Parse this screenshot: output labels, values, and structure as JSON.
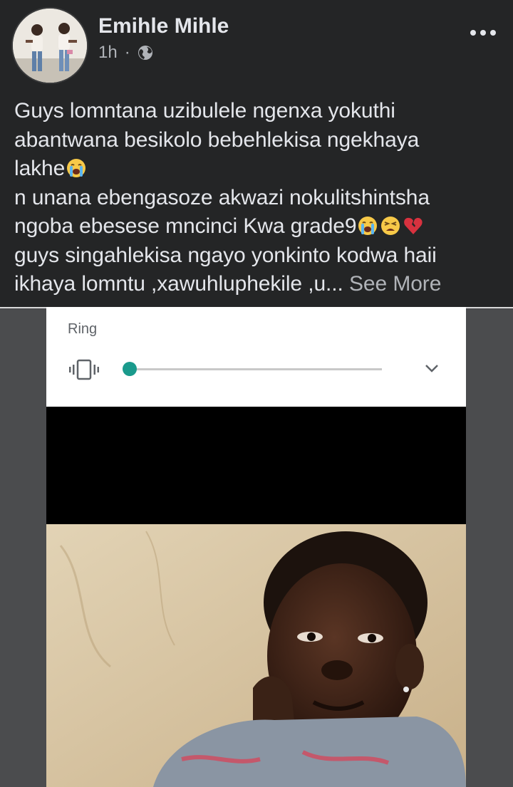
{
  "post": {
    "author": "Emihle Mihle",
    "time": "1h",
    "separator": "·",
    "privacy_icon": "globe-icon",
    "more_icon": "more-options-icon",
    "text_lines": [
      "Guys lomntana uzibulele ngenxa yokuthi",
      "abantwana besikolo bebehlekisa ngekhaya",
      "lakhe",
      "n unana ebengasoze akwazi nokulitshintsha",
      "ngoba ebesese mncinci Kwa grade9",
      "guys singahlekisa ngayo yonkinto kodwa haii",
      "ikhaya lomntu ,xawuhluphekile ,u..."
    ],
    "see_more": "See More",
    "emojis": [
      "loudly-crying-face",
      "loudly-crying-face",
      "weary-face",
      "broken-heart"
    ]
  },
  "photo": {
    "ring_panel": {
      "label": "Ring",
      "volume_level": 0,
      "vibrate_icon": "vibrate-icon",
      "expand_icon": "chevron-down-icon",
      "accent_color": "#1a9a8c"
    }
  },
  "colors": {
    "background": "#242526",
    "primary_text": "#e4e6eb",
    "secondary_text": "#b0b3b8"
  }
}
